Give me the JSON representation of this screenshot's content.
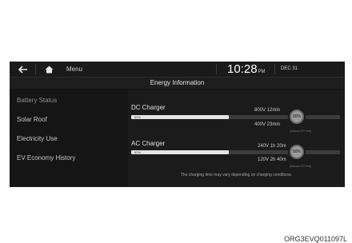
{
  "topbar": {
    "menu_label": "Menu",
    "time": "10:28",
    "ampm": "PM",
    "date": "DEC 31"
  },
  "header": {
    "title": "Energy Information"
  },
  "sidebar": {
    "items": [
      {
        "label": "Battery Status"
      },
      {
        "label": "Solar Roof"
      },
      {
        "label": "Electricity Use"
      },
      {
        "label": "EV Economy History"
      }
    ]
  },
  "chargers": [
    {
      "label": "DC Charger",
      "bar_percent": "62%",
      "level_percent": 62,
      "target_percent": "80%",
      "high_time": "800V 12min",
      "low_time": "400V 23min",
      "sub_note": "(About 470 km)"
    },
    {
      "label": "AC Charger",
      "bar_percent": "62%",
      "level_percent": 62,
      "target_percent": "80%",
      "high_time": "240V 1h 20m",
      "low_time": "120V 2h 40m",
      "sub_note": "(About 470 km)"
    }
  ],
  "note": "The charging time may vary depending on charging conditions.",
  "image_code": "ORG3EVQ011097L"
}
